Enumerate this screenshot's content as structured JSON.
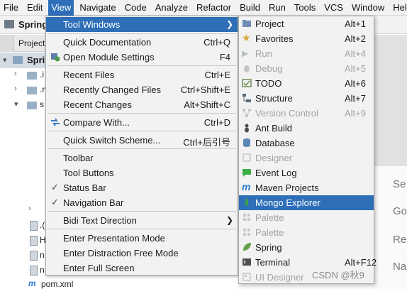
{
  "menubar": [
    "File",
    "Edit",
    "View",
    "Navigate",
    "Code",
    "Analyze",
    "Refactor",
    "Build",
    "Run",
    "Tools",
    "VCS",
    "Window",
    "Help"
  ],
  "title_strip": {
    "project": "Spring"
  },
  "project_panel": {
    "tab": "Project",
    "root": "Spri"
  },
  "tree": [
    {
      "text": ".i"
    },
    {
      "text": ".n"
    },
    {
      "text": "s"
    },
    {
      "text": ""
    },
    {
      "text": ".("
    },
    {
      "text": "H"
    },
    {
      "text": "n"
    },
    {
      "text": "n"
    },
    {
      "text": "pom.xml"
    }
  ],
  "editor_hints": [
    "Se",
    "Go",
    "Re",
    "Na"
  ],
  "view_menu": {
    "items": [
      {
        "label": "Tool Windows",
        "submenu": true
      },
      {
        "label": "Quick Documentation",
        "shortcut": "Ctrl+Q"
      },
      {
        "label": "Open Module Settings",
        "shortcut": "F4"
      },
      {
        "label": "Recent Files",
        "shortcut": "Ctrl+E"
      },
      {
        "label": "Recently Changed Files",
        "shortcut": "Ctrl+Shift+E"
      },
      {
        "label": "Recent Changes",
        "shortcut": "Alt+Shift+C"
      },
      {
        "label": "Compare With...",
        "shortcut": "Ctrl+D"
      },
      {
        "label": "Quick Switch Scheme...",
        "shortcut": "Ctrl+后引号"
      },
      {
        "label": "Toolbar"
      },
      {
        "label": "Tool Buttons"
      },
      {
        "label": "Status Bar"
      },
      {
        "label": "Navigation Bar"
      },
      {
        "label": "Bidi Text Direction",
        "submenu": true
      },
      {
        "label": "Enter Presentation Mode"
      },
      {
        "label": "Enter Distraction Free Mode"
      },
      {
        "label": "Enter Full Screen"
      }
    ]
  },
  "tool_windows": {
    "items": [
      {
        "label": "Project",
        "shortcut": "Alt+1",
        "icon": "folder-icon",
        "color": "#6e8fb3"
      },
      {
        "label": "Favorites",
        "shortcut": "Alt+2",
        "icon": "star-icon",
        "color": "#d9a43b"
      },
      {
        "label": "Run",
        "shortcut": "Alt+4",
        "icon": "play-icon",
        "color": "#b9c2b9"
      },
      {
        "label": "Debug",
        "shortcut": "Alt+5",
        "icon": "bug-icon",
        "color": "#bcbcbc"
      },
      {
        "label": "TODO",
        "shortcut": "Alt+6",
        "icon": "todo-icon",
        "color": "#6d8e55"
      },
      {
        "label": "Structure",
        "shortcut": "Alt+7",
        "icon": "structure-icon",
        "color": "#5a6a7a"
      },
      {
        "label": "Version Control",
        "shortcut": "Alt+9",
        "icon": "vcs-icon",
        "color": "#c2c2c2"
      },
      {
        "label": "Ant Build",
        "shortcut": "",
        "icon": "ant-icon",
        "color": "#4c4c4c"
      },
      {
        "label": "Database",
        "shortcut": "",
        "icon": "database-icon",
        "color": "#5b87b5"
      },
      {
        "label": "Designer",
        "shortcut": "",
        "icon": "designer-icon",
        "color": "#c6c6c6"
      },
      {
        "label": "Event Log",
        "shortcut": "",
        "icon": "event-log-icon",
        "color": "#3cae43"
      },
      {
        "label": "Maven Projects",
        "shortcut": "",
        "icon": "maven-icon",
        "color": "#2c7bd1"
      },
      {
        "label": "Mongo Explorer",
        "shortcut": "",
        "icon": "mongo-leaf-icon",
        "color": "#3aa24a"
      },
      {
        "label": "Palette",
        "shortcut": "",
        "icon": "palette-icon",
        "color": "#c8c8c8"
      },
      {
        "label": "Palette",
        "shortcut": "",
        "icon": "palette-icon",
        "color": "#c8c8c8"
      },
      {
        "label": "Spring",
        "shortcut": "",
        "icon": "spring-icon",
        "color": "#62a04b"
      },
      {
        "label": "Terminal",
        "shortcut": "Alt+F12",
        "icon": "terminal-icon",
        "color": "#4f4f4f"
      },
      {
        "label": "UI Designer",
        "shortcut": "",
        "icon": "ui-designer-icon",
        "color": "#c8c8c8"
      }
    ]
  },
  "watermark": "CSDN @秋9"
}
